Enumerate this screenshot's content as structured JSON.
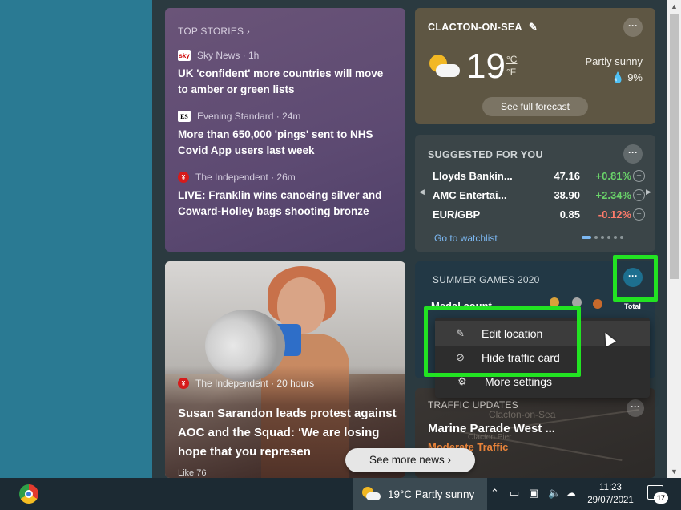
{
  "top_stories": {
    "header": "TOP STORIES",
    "items": [
      {
        "source": "Sky News · 1h",
        "headline": "UK 'confident' more countries will move to amber or green lists"
      },
      {
        "source": "Evening Standard · 24m",
        "headline": "More than 650,000 'pings' sent to NHS Covid App users last week"
      },
      {
        "source": "The Independent · 26m",
        "headline": "LIVE: Franklin wins canoeing silver and Coward-Holley bags shooting bronze"
      }
    ]
  },
  "photo_story": {
    "source": "The Independent · 20 hours",
    "headline": "Susan Sarandon leads protest against AOC and the Squad: ‘We are losing hope that you represen",
    "reactions": "Like  76"
  },
  "weather": {
    "location": "CLACTON-ON-SEA",
    "temp": "19",
    "unit_c": "°C",
    "unit_f": "°F",
    "condition": "Partly sunny",
    "precip": "9%",
    "forecast_button": "See full forecast"
  },
  "suggested": {
    "title": "SUGGESTED FOR YOU",
    "stocks": [
      {
        "name": "Lloyds Bankin...",
        "price": "47.16",
        "change": "+0.81%"
      },
      {
        "name": "AMC Entertai...",
        "price": "38.90",
        "change": "+2.34%"
      },
      {
        "name": "EUR/GBP",
        "price": "0.85",
        "change": "-0.12%"
      }
    ],
    "watchlist_link": "Go to watchlist"
  },
  "games": {
    "title": "SUMMER GAMES 2020",
    "medals_label": "Medal count",
    "total_label": "Total"
  },
  "traffic": {
    "title": "TRAFFIC UPDATES",
    "road": "Marine Parade West ...",
    "status": "Moderate Traffic",
    "map_label_1": "Clacton-on-Sea",
    "map_label_2": "Clacton Pier"
  },
  "context_menu": {
    "items": [
      {
        "icon": "pencil-icon",
        "label": "Edit location"
      },
      {
        "icon": "eye-off-icon",
        "label": "Hide traffic card"
      },
      {
        "icon": "gear-icon",
        "label": "More settings"
      }
    ]
  },
  "see_more": "See more news",
  "taskbar": {
    "weather_text": "19°C  Partly sunny",
    "time": "11:23",
    "date": "29/07/2021",
    "notifications": "17"
  },
  "colors": {
    "highlight": "#22e322",
    "positive": "#6ad36a",
    "negative": "#ff7b6b",
    "link": "#7cb8f2"
  }
}
